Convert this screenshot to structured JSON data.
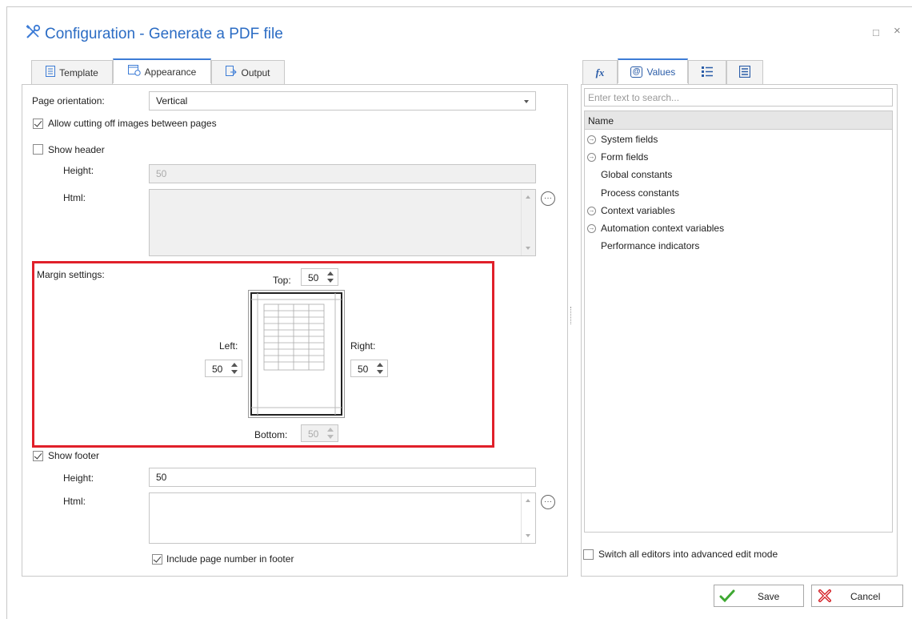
{
  "dialog": {
    "title": "Configuration - Generate a PDF file",
    "window_controls": {
      "maximize": "□",
      "close": "×"
    }
  },
  "left_tabs": [
    {
      "label": "Template",
      "icon": "template-icon"
    },
    {
      "label": "Appearance",
      "icon": "appearance-icon",
      "active": true
    },
    {
      "label": "Output",
      "icon": "output-icon"
    }
  ],
  "appearance": {
    "page_orientation": {
      "label": "Page orientation:",
      "value": "Vertical"
    },
    "allow_cutting": {
      "label": "Allow cutting off images between pages",
      "checked": true
    },
    "show_header": {
      "label": "Show header",
      "checked": false
    },
    "header_height": {
      "label": "Height:",
      "value": "50"
    },
    "header_html": {
      "label": "Html:"
    },
    "margins": {
      "label": "Margin settings:",
      "top": {
        "label": "Top:",
        "value": "50"
      },
      "left": {
        "label": "Left:",
        "value": "50"
      },
      "right": {
        "label": "Right:",
        "value": "50"
      },
      "bottom": {
        "label": "Bottom:",
        "value": "50"
      }
    },
    "show_footer": {
      "label": "Show footer",
      "checked": true
    },
    "footer_height": {
      "label": "Height:",
      "value": "50"
    },
    "footer_html": {
      "label": "Html:"
    },
    "include_page_number": {
      "label": "Include page number in footer",
      "checked": true
    }
  },
  "right_tabs": [
    {
      "label": "",
      "icon": "function-icon",
      "glyph": "fx"
    },
    {
      "label": "Values",
      "icon": "values-icon",
      "glyph": "ⓐ",
      "active": true
    },
    {
      "label": "",
      "icon": "list-icon",
      "glyph": "☰"
    },
    {
      "label": "",
      "icon": "form-icon",
      "glyph": "▣"
    }
  ],
  "values_panel": {
    "search_placeholder": "Enter text to search...",
    "column_header": "Name",
    "items": [
      {
        "label": "System fields",
        "expandable": true
      },
      {
        "label": "Form fields",
        "expandable": true
      },
      {
        "label": "Global constants",
        "expandable": false
      },
      {
        "label": "Process constants",
        "expandable": false
      },
      {
        "label": "Context variables",
        "expandable": true
      },
      {
        "label": "Automation context variables",
        "expandable": true
      },
      {
        "label": "Performance indicators",
        "expandable": false
      }
    ],
    "advanced_mode": {
      "label": "Switch all editors into advanced edit mode",
      "checked": false
    }
  },
  "buttons": {
    "save": "Save",
    "cancel": "Cancel"
  },
  "colors": {
    "accent": "#3d7cd6",
    "title": "#2b6cc4",
    "highlight": "#e0202a",
    "save_icon": "#3ea832",
    "cancel_icon": "#d42026"
  }
}
